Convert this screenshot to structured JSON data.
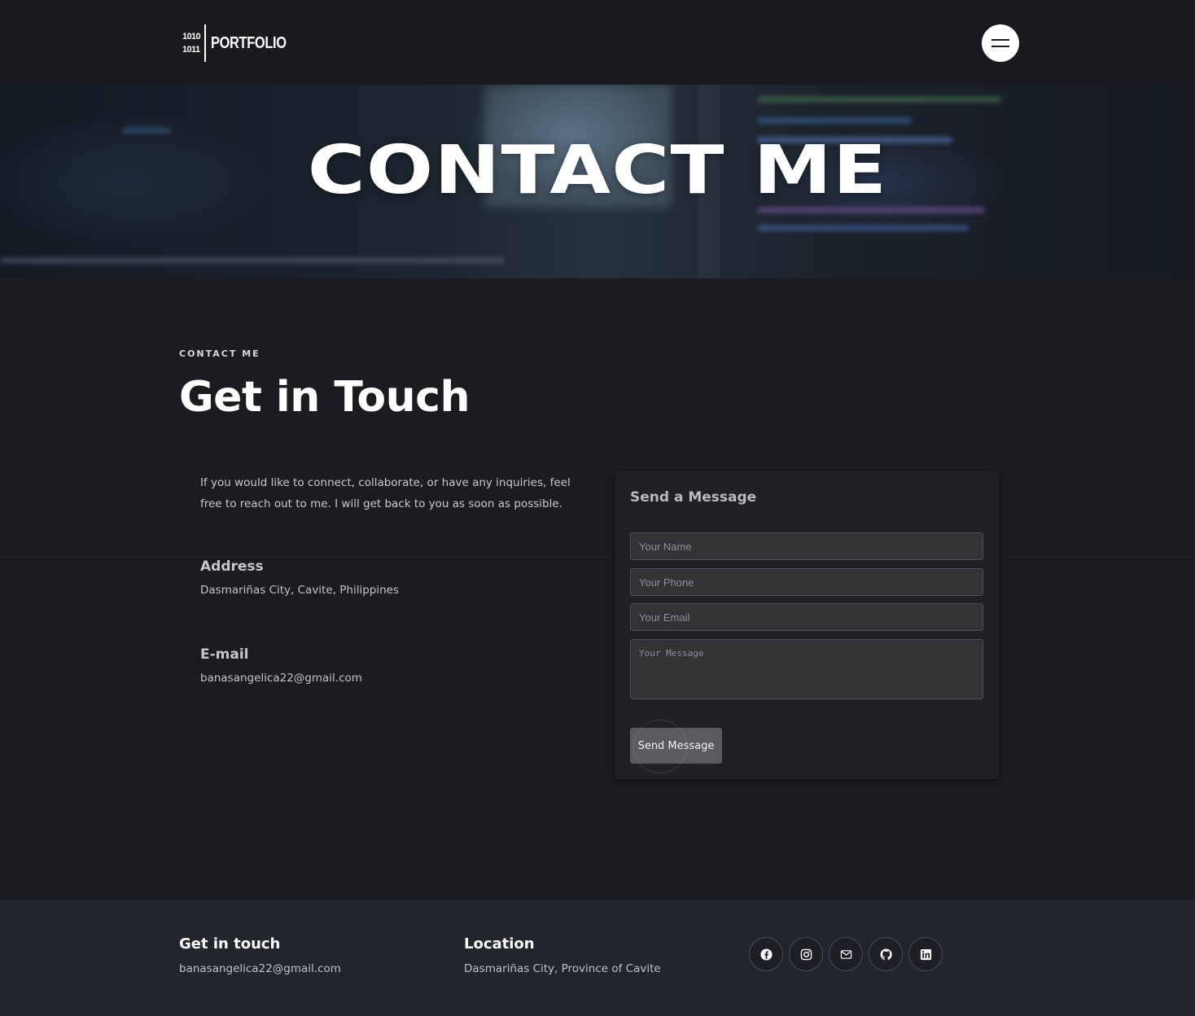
{
  "header": {
    "logo_bits_top": "1010",
    "logo_bits_bottom": "1011",
    "logo_word": "PORTFOLIO"
  },
  "hero": {
    "title": "CONTACT ME"
  },
  "contact": {
    "eyebrow": "CONTACT ME",
    "title": "Get in Touch",
    "intro": "If you would like to connect, collaborate, or have any inquiries, feel free to reach out to me. I will get back to you as soon as possible.",
    "address_heading": "Address",
    "address_text": "Dasmariñas City, Cavite, Philippines",
    "email_heading": "E-mail",
    "email_text": "banasangelica22@gmail.com"
  },
  "form": {
    "title": "Send a Message",
    "name_placeholder": "Your Name",
    "phone_placeholder": "Your Phone",
    "email_placeholder": "Your Email",
    "message_placeholder": "Your Message",
    "submit_label": "Send Message"
  },
  "footer": {
    "touch_heading": "Get in touch",
    "touch_text": "banasangelica22@gmail.com",
    "location_heading": "Location",
    "location_text": "Dasmariñas City, Province of Cavite",
    "socials": [
      "facebook-icon",
      "instagram-icon",
      "mail-icon",
      "github-icon",
      "linkedin-icon"
    ]
  },
  "colors": {
    "page_bg": "#1a1c22",
    "header_bg": "#181a20",
    "card_bg": "#202124",
    "footer_bg": "#23252c",
    "button_bg": "#5a5b5e"
  }
}
